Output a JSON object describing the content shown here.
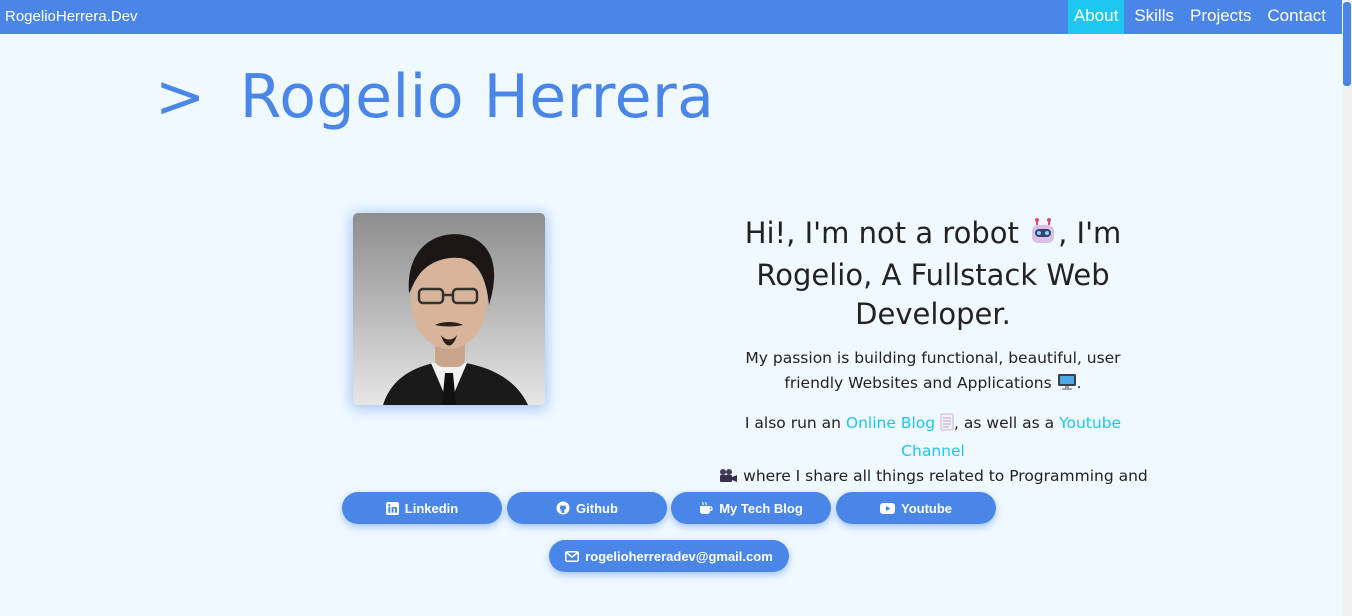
{
  "nav": {
    "brand": "RogelioHerrera.Dev",
    "links": [
      "About",
      "Skills",
      "Projects",
      "Contact"
    ],
    "active": "About"
  },
  "hero": {
    "prompt": ">",
    "name": "Rogelio Herrera"
  },
  "intro": {
    "heading_part1": "Hi!, I'm not a robot",
    "heading_part2": ", I'm Rogelio, A Fullstack Web Developer.",
    "passion_text": "My passion is building functional, beautiful, user friendly Websites and Applications",
    "passion_end": ".",
    "blog_prefix": "I also run an ",
    "blog_link": "Online Blog",
    "blog_mid": ", as well as a ",
    "youtube_link": "Youtube Channel",
    "blog_suffix": " where I share all things related to Programming and IT."
  },
  "buttons": {
    "linkedin": "Linkedin",
    "github": "Github",
    "blog": "My Tech Blog",
    "youtube": "Youtube",
    "email": "rogelioherreradev@gmail.com"
  },
  "icons": {
    "robot": "robot-emoji",
    "computer": "computer-emoji",
    "blog": "notepad-emoji",
    "camera": "movie-camera-emoji"
  },
  "colors": {
    "accent": "#4a86e8",
    "active_nav": "#1ec7f0",
    "link": "#1ec7f0",
    "background": "#f0f9ff"
  }
}
